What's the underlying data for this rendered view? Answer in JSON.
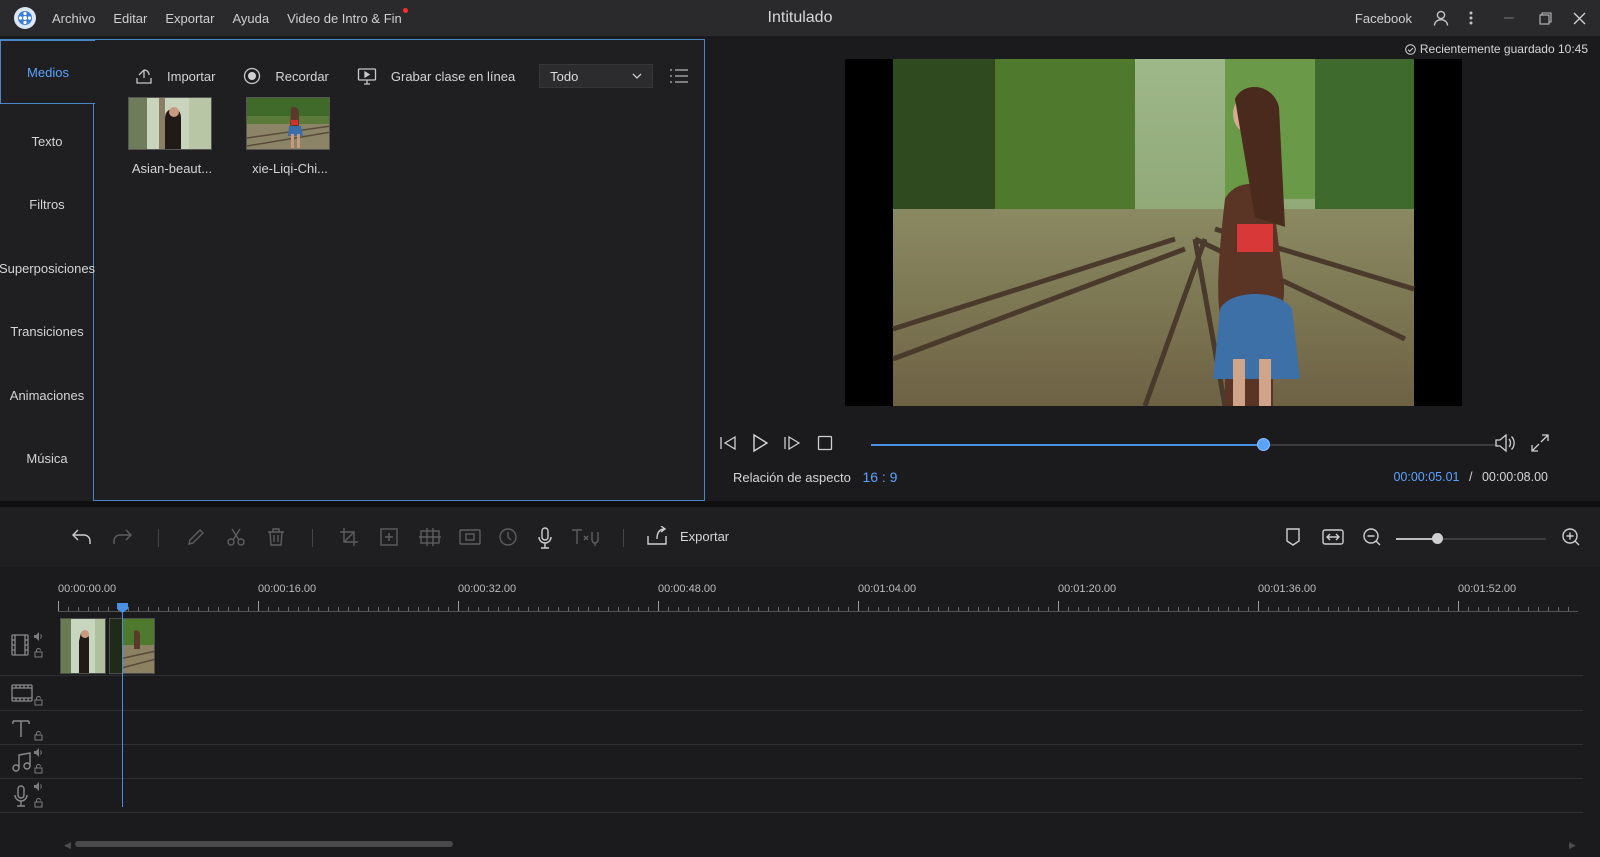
{
  "titlebar": {
    "menu": [
      "Archivo",
      "Editar",
      "Exportar",
      "Ayuda",
      "Video de Intro & Fin"
    ],
    "title": "Intitulado",
    "facebook": "Facebook"
  },
  "sidenav": {
    "items": [
      "Medios",
      "Texto",
      "Filtros",
      "Superposiciones",
      "Transiciones",
      "Animaciones",
      "Música"
    ],
    "active": "Medios"
  },
  "media_toolbar": {
    "import": "Importar",
    "record": "Recordar",
    "grab_class": "Grabar clase en línea",
    "filter_value": "Todo"
  },
  "media_items": [
    {
      "name": "Asian-beaut..."
    },
    {
      "name": "xie-Liqi-Chi..."
    }
  ],
  "preview": {
    "saved": "Recientemente guardado 10:45",
    "aspect_label": "Relación de aspecto",
    "aspect_value": "16 : 9",
    "current_time": "00:00:05.01",
    "time_separator": "/",
    "total_time": "00:00:08.00",
    "progress_percent": 62.5
  },
  "edit_toolbar": {
    "export": "Exportar",
    "zoom_percent": 27
  },
  "timeline": {
    "ruler_labels": [
      "00:00:00.00",
      "00:00:16.00",
      "00:00:32.00",
      "00:00:48.00",
      "00:01:04.00",
      "00:01:20.00",
      "00:01:36.00",
      "00:01:52.00"
    ]
  },
  "colors": {
    "accent": "#5aa2ff",
    "panel_border": "#4d86c6",
    "background": "#1b1b1d"
  }
}
